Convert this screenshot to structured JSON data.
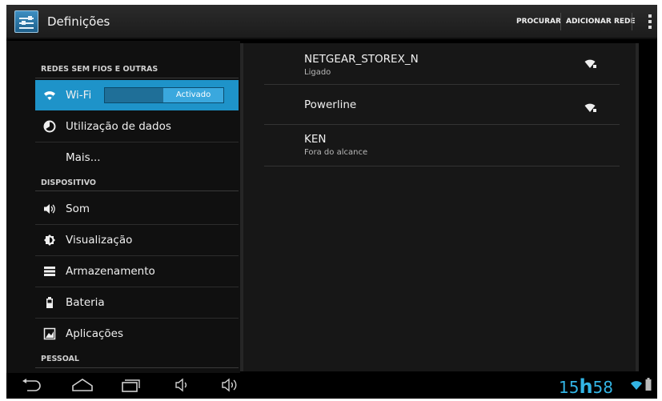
{
  "app": {
    "title": "Definições"
  },
  "actionbar": {
    "search_label": "PROCURAR",
    "add_network_label": "ADICIONAR REDE"
  },
  "sidebar": {
    "categories": [
      "REDES SEM FIOS E OUTRAS",
      "DISPOSITIVO",
      "PESSOAL"
    ],
    "wifi": {
      "label": "Wi-Fi",
      "toggle_state": "Activado",
      "icon": "wifi-icon"
    },
    "items": [
      {
        "label": "Utilização de dados",
        "icon": "data-usage-icon"
      },
      {
        "label": "Mais...",
        "icon": ""
      },
      {
        "label": "Som",
        "icon": "speaker-icon"
      },
      {
        "label": "Visualização",
        "icon": "display-icon"
      },
      {
        "label": "Armazenamento",
        "icon": "storage-icon"
      },
      {
        "label": "Bateria",
        "icon": "battery-icon"
      },
      {
        "label": "Aplicações",
        "icon": "apps-icon"
      }
    ]
  },
  "networks": [
    {
      "ssid": "NETGEAR_STOREX_N",
      "status": "Ligado",
      "secured": true
    },
    {
      "ssid": "Powerline",
      "status": "",
      "secured": true
    },
    {
      "ssid": "KEN",
      "status": "Fora do alcance",
      "secured": false
    }
  ],
  "statusbar": {
    "clock_hours": "15",
    "clock_sep": "h",
    "clock_minutes": "58"
  },
  "colors": {
    "accent": "#33b5e5",
    "selected": "#1e93c9"
  }
}
